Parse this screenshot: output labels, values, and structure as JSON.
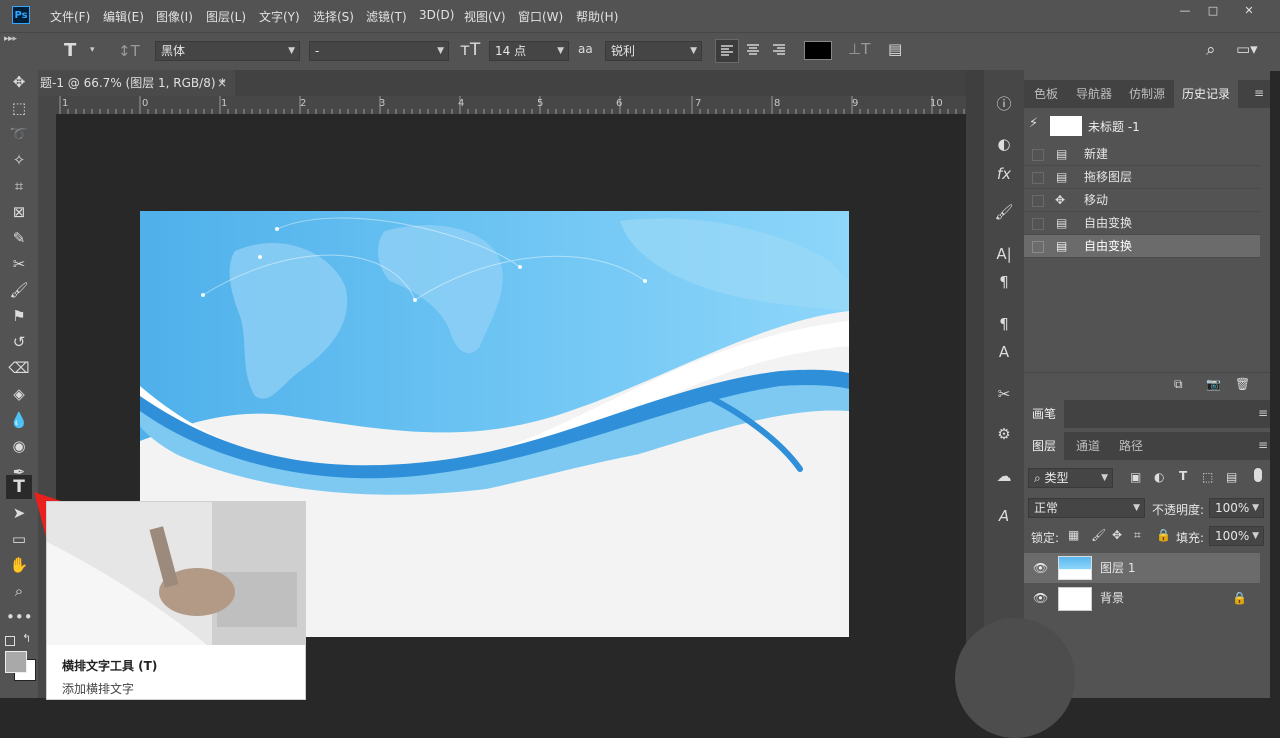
{
  "app": {
    "logo": "Ps"
  },
  "menu": [
    "文件(F)",
    "编辑(E)",
    "图像(I)",
    "图层(L)",
    "文字(Y)",
    "选择(S)",
    "滤镜(T)",
    "3D(D)",
    "视图(V)",
    "窗口(W)",
    "帮助(H)"
  ],
  "window_controls": {
    "minimize": "—",
    "maximize": "□",
    "close": "✕"
  },
  "options": {
    "font_family": "黑体",
    "font_style": "-",
    "font_size": "14 点",
    "antialias_icon": "aa",
    "antialias": "锐利",
    "text_color": "#000000"
  },
  "document": {
    "tab_title": "题-1 @ 66.7% (图层 1, RGB/8) *",
    "close": "×",
    "ruler_numbers": [
      "1",
      "0",
      "1",
      "2",
      "3",
      "4",
      "5",
      "6",
      "7",
      "8",
      "9",
      "10"
    ]
  },
  "history_panel": {
    "tabs": [
      "色板",
      "导航器",
      "仿制源",
      "历史记录"
    ],
    "snapshot_name": "未标题 -1",
    "items": [
      "新建",
      "拖移图层",
      "移动",
      "自由变换",
      "自由变换"
    ]
  },
  "brush_panel": {
    "title": "画笔"
  },
  "layers_panel": {
    "tabs": [
      "图层",
      "通道",
      "路径"
    ],
    "filter_label": "类型",
    "blend_mode": "正常",
    "opacity_label": "不透明度:",
    "opacity_value": "100%",
    "lock_label": "锁定:",
    "fill_label": "填充:",
    "fill_value": "100%",
    "layers": [
      {
        "name": "图层 1",
        "selected": true
      },
      {
        "name": "背景",
        "locked": true
      }
    ]
  },
  "tooltip": {
    "title": "横排文字工具 (T)",
    "description": "添加横排文字"
  },
  "colors": {
    "chrome": "#535353",
    "canvas_bg": "#282828",
    "arrow": "#e8201e",
    "accent_blue": "#5ab8ef"
  }
}
